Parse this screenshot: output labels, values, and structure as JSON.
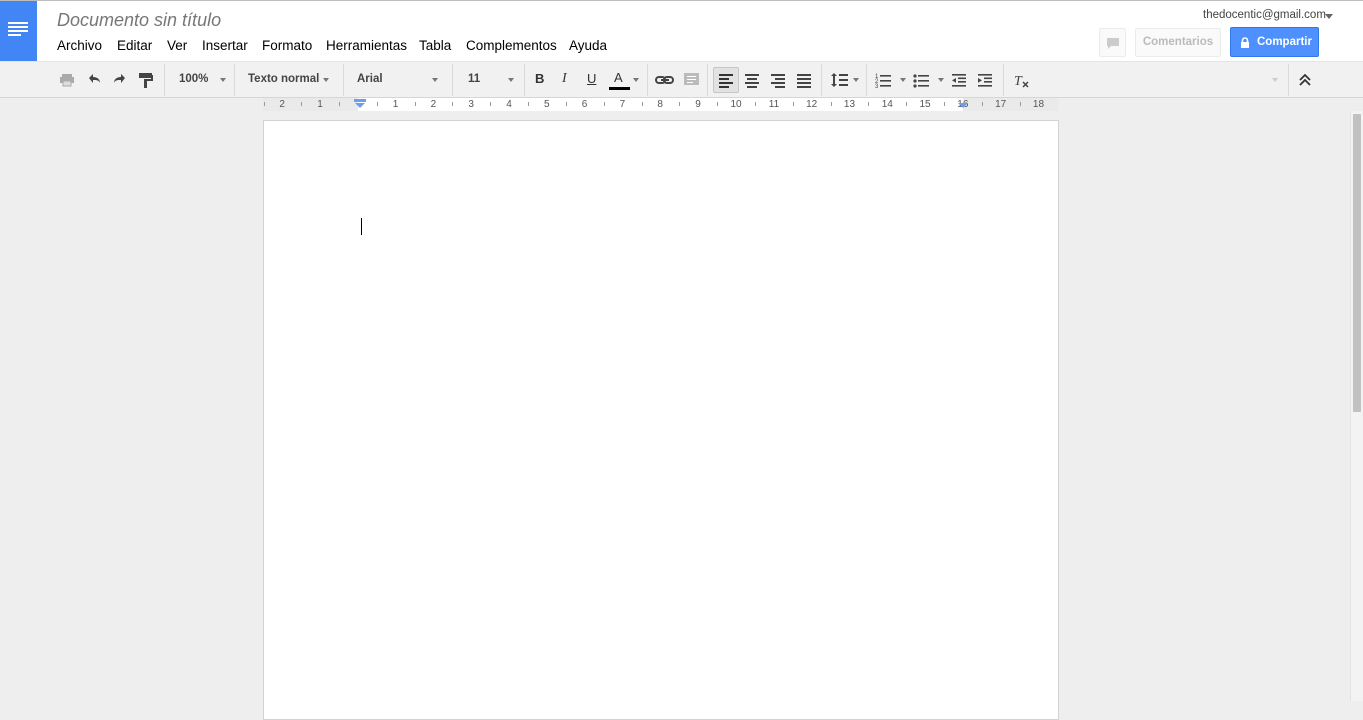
{
  "app": {
    "doc_title": "Documento sin título",
    "account_email": "thedocentic@gmail.com",
    "brand_color": "#4285f4"
  },
  "menu": [
    "Archivo",
    "Editar",
    "Ver",
    "Insertar",
    "Formato",
    "Herramientas",
    "Tabla",
    "Complementos",
    "Ayuda"
  ],
  "header_buttons": {
    "comments_label": "Comentarios",
    "share_label": "Compartir",
    "share_color": "#4d90fe"
  },
  "toolbar": {
    "zoom": "100%",
    "style": "Texto normal",
    "font": "Arial",
    "size": "11",
    "icons": [
      "print-icon",
      "undo-icon",
      "redo-icon",
      "paint-format-icon",
      "bold-icon",
      "italic-icon",
      "underline-icon",
      "text-color-icon",
      "link-icon",
      "comment-icon",
      "align-left-icon",
      "align-center-icon",
      "align-right-icon",
      "justify-icon",
      "line-spacing-icon",
      "numbered-list-icon",
      "bulleted-list-icon",
      "decrease-indent-icon",
      "increase-indent-icon",
      "clear-formatting-icon",
      "collapse-icon"
    ],
    "text_color": "#000000"
  },
  "ruler": {
    "left_numbers": [
      "2",
      "1"
    ],
    "right_numbers": [
      "1",
      "2",
      "3",
      "4",
      "5",
      "6",
      "7",
      "8",
      "9",
      "10",
      "11",
      "12",
      "13",
      "14",
      "15",
      "16",
      "17",
      "18"
    ]
  }
}
